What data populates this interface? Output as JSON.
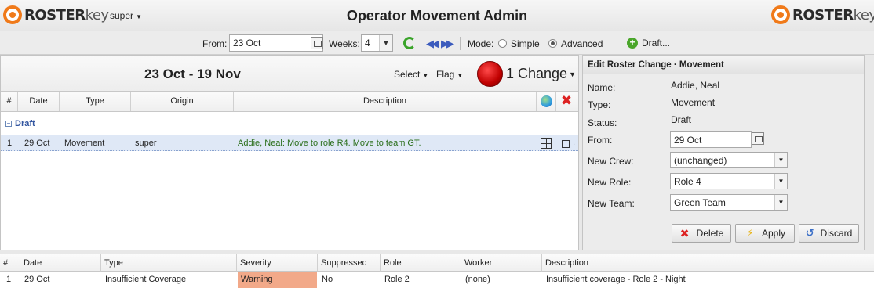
{
  "header": {
    "brand_left": {
      "a": "ROSTER",
      "b": "key"
    },
    "brand_right": {
      "a": "ROSTER",
      "b": "key"
    },
    "user": "super",
    "title": "Operator Movement Admin"
  },
  "toolbar": {
    "from_label": "From:",
    "from_value": "23 Oct",
    "weeks_label": "Weeks:",
    "weeks_value": "4",
    "mode_label": "Mode:",
    "mode_simple": "Simple",
    "mode_advanced": "Advanced",
    "mode_selected": "Advanced",
    "draft_label": "Draft..."
  },
  "left": {
    "range_title": "23 Oct - 19 Nov",
    "select_label": "Select",
    "flag_label": "Flag",
    "change_label": "1 Change",
    "columns": [
      "#",
      "Date",
      "Type",
      "Origin",
      "Description"
    ],
    "group_label": "Draft",
    "rows": [
      {
        "num": "1",
        "date": "29 Oct",
        "type": "Movement",
        "origin": "super",
        "description": "Addie, Neal: Move to role R4. Move to team GT."
      }
    ]
  },
  "edit": {
    "title": "Edit Roster Change · Movement",
    "name_label": "Name:",
    "name_value": "Addie, Neal",
    "type_label": "Type:",
    "type_value": "Movement",
    "status_label": "Status:",
    "status_value": "Draft",
    "from_label": "From:",
    "from_value": "29 Oct",
    "crew_label": "New Crew:",
    "crew_value": "(unchanged)",
    "role_label": "New Role:",
    "role_value": "Role 4",
    "team_label": "New Team:",
    "team_value": "Green Team",
    "delete_label": "Delete",
    "apply_label": "Apply",
    "discard_label": "Discard"
  },
  "issues": {
    "columns": [
      "#",
      "Date",
      "Type",
      "Severity",
      "Suppressed",
      "Role",
      "Worker",
      "Description"
    ],
    "rows": [
      {
        "num": "1",
        "date": "29 Oct",
        "type": "Insufficient Coverage",
        "severity": "Warning",
        "suppressed": "No",
        "role": "Role 2",
        "worker": "(none)",
        "description": "Insufficient coverage - Role 2 - Night"
      }
    ],
    "warning_color": "#f2a989"
  },
  "icons": [
    "roster-logo-icon",
    "calendar-icon",
    "refresh-icon",
    "prev-arrow-icon",
    "next-arrow-icon",
    "plus-icon",
    "red-orb-icon",
    "globe-icon",
    "close-icon",
    "grid-icon",
    "checkbox-icon",
    "delete-icon",
    "apply-icon",
    "discard-icon"
  ]
}
